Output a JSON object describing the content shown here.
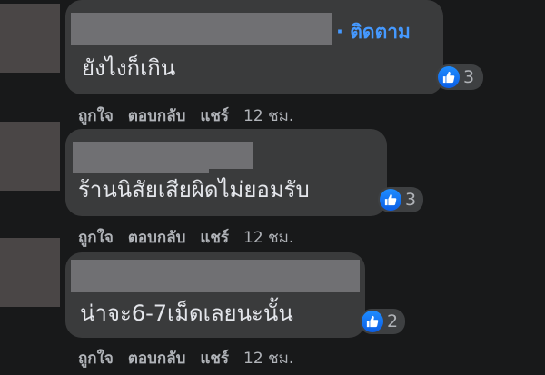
{
  "comments": [
    {
      "follow_label": "ติดตาม",
      "text": "ยังไงก็เกิน",
      "reaction_count": "3",
      "actions": {
        "like": "ถูกใจ",
        "reply": "ตอบกลับ",
        "share": "แชร์",
        "time": "12 ชม."
      }
    },
    {
      "text": "ร้านนิสัยเสียผิดไม่ยอมรับ",
      "reaction_count": "3",
      "actions": {
        "like": "ถูกใจ",
        "reply": "ตอบกลับ",
        "share": "แชร์",
        "time": "12 ชม."
      }
    },
    {
      "text": "น่าจะ6-7เม็ดเลยนะนั้น",
      "reaction_count": "2",
      "actions": {
        "like": "ถูกใจ",
        "reply": "ตอบกลับ",
        "share": "แชร์",
        "time": "12 ชม."
      }
    }
  ],
  "colors": {
    "background": "#18191a",
    "bubble": "#3a3b3c",
    "accent": "#4599ff",
    "like": "#1877f2"
  }
}
